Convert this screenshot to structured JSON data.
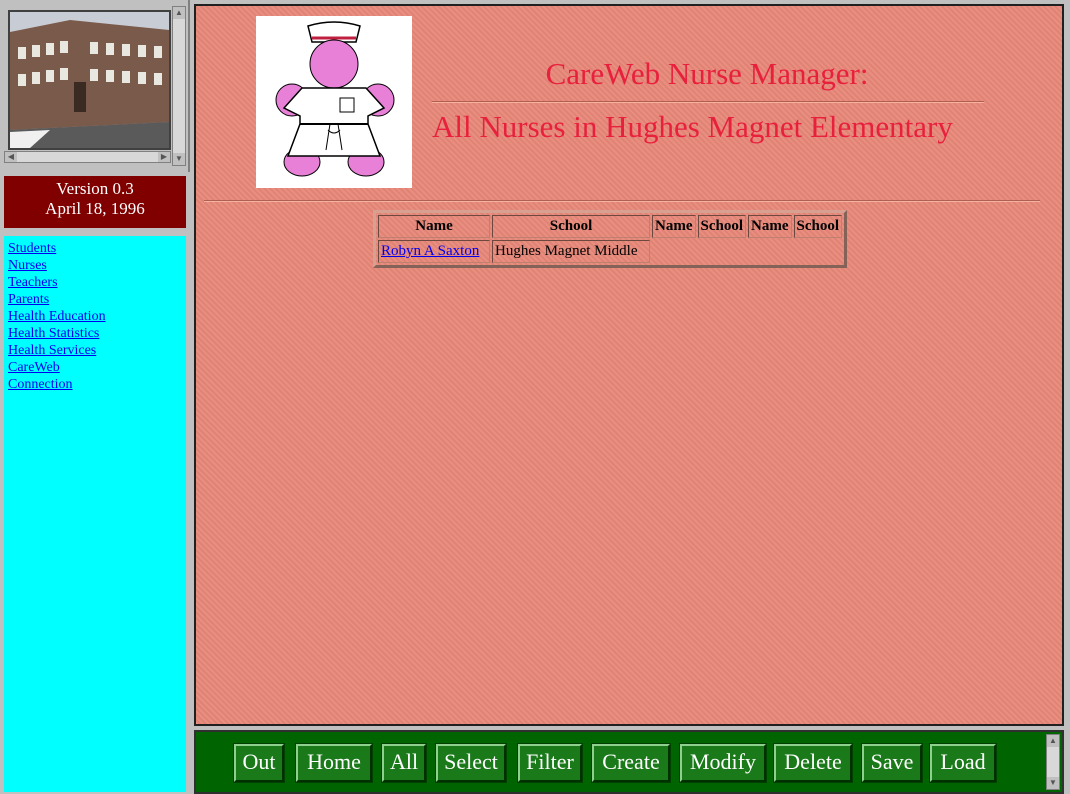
{
  "version": {
    "label": "Version 0.3",
    "date": "April 18, 1996",
    "bg_color": "#800000"
  },
  "nav": {
    "bg_color": "#00ffff",
    "links": [
      "Students",
      "Nurses",
      "Teachers",
      "Parents",
      "Health Education",
      "Health Statistics",
      "Health Services",
      "CareWeb",
      "Connection"
    ]
  },
  "main": {
    "title_line1": "CareWeb Nurse Manager:",
    "title_line2": "All Nurses in Hughes Magnet Elementary",
    "title_color": "#e8203c",
    "bg_color": "#e8887a",
    "table": {
      "headers": [
        "Name",
        "School",
        "Name",
        "School",
        "Name",
        "School"
      ],
      "rows": [
        {
          "name": "Robyn A Saxton",
          "school": "Hughes Magnet Middle"
        }
      ]
    }
  },
  "toolbar": {
    "bg_color": "#006400",
    "buttons": [
      "Out",
      "Home",
      "All",
      "Select",
      "Filter",
      "Create",
      "Modify",
      "Delete",
      "Save",
      "Load"
    ]
  },
  "icons": {
    "logo": "nurse-figure-icon",
    "photo": "school-building-photo"
  }
}
